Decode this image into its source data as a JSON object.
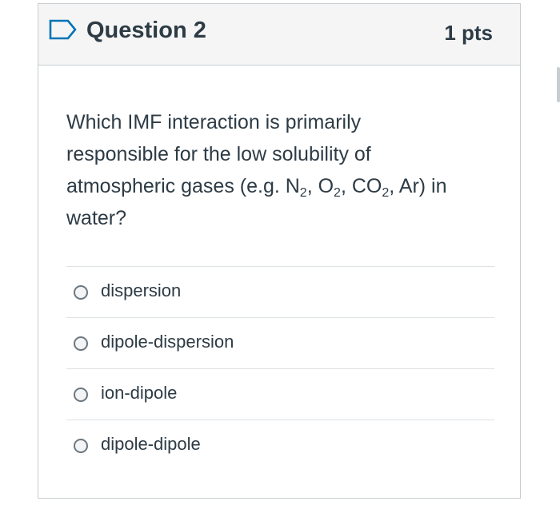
{
  "question": {
    "title": "Question 2",
    "points": "1 pts",
    "text_line1": "Which IMF interaction is primarily",
    "text_line2": "responsible for the low solubility of",
    "text_line3_a": "atmospheric gases (e.g. N",
    "sub_n": "2",
    "text_line3_b": ", O",
    "sub_o": "2",
    "text_line3_c": ", CO",
    "sub_co": "2",
    "text_line3_d": ", Ar) in",
    "text_line4": "water?"
  },
  "answers": [
    {
      "label": "dispersion",
      "selected": false
    },
    {
      "label": "dipole-dispersion",
      "selected": false
    },
    {
      "label": "ion-dipole",
      "selected": false
    },
    {
      "label": "dipole-dipole",
      "selected": false
    }
  ],
  "colors": {
    "header_bg": "#f5f5f5",
    "flag_icon": "#0374b5",
    "text": "#2d3b45",
    "border": "#c7cdd1"
  },
  "icons": {
    "flag": "bookmark-flag-icon",
    "radio": "radio-button-icon"
  }
}
